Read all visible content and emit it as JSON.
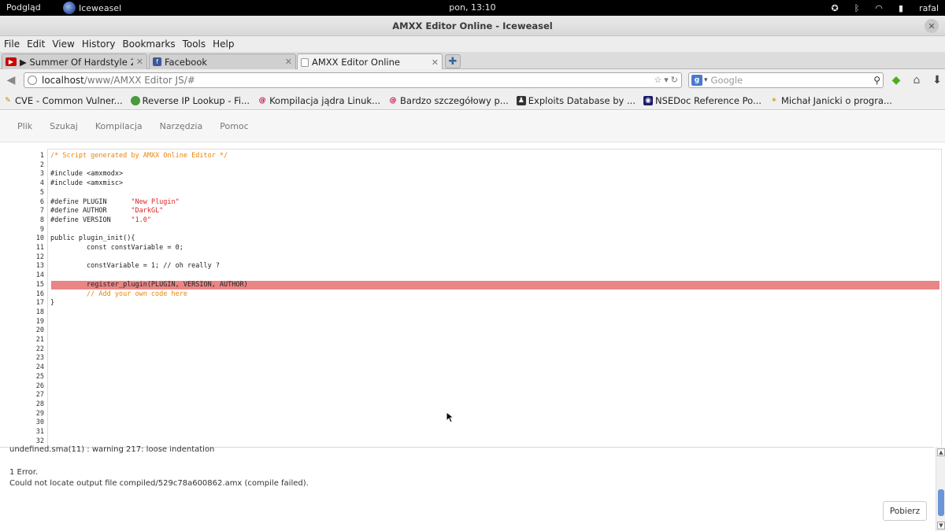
{
  "topbar": {
    "activities": "Podgląd",
    "app_name": "Iceweasel",
    "clock": "pon, 13:10",
    "user": "rafal"
  },
  "window": {
    "title": "AMXX Editor Online - Iceweasel"
  },
  "menu": [
    "File",
    "Edit",
    "View",
    "History",
    "Bookmarks",
    "Tools",
    "Help"
  ],
  "tabs": [
    {
      "label": "▶ Summer Of Hardstyle 20...",
      "icon": "youtube-icon"
    },
    {
      "label": "Facebook",
      "icon": "facebook-icon"
    },
    {
      "label": "AMXX Editor Online",
      "icon": "blank-page-icon"
    }
  ],
  "navbar": {
    "url_host": "localhost",
    "url_path": "/www/AMXX Editor JS/#",
    "search_placeholder": "Google"
  },
  "bookmarks": [
    {
      "label": "CVE - Common Vulner...",
      "icon": "cve-icon",
      "color": "#b58b00"
    },
    {
      "label": "Reverse IP Lookup - Fi...",
      "icon": "globe-icon",
      "color": "#4a9a3a"
    },
    {
      "label": "Kompilacja jądra Linuk...",
      "icon": "debian-icon",
      "color": "#c70036"
    },
    {
      "label": "Bardzo szczegółowy p...",
      "icon": "debian-icon",
      "color": "#c70036"
    },
    {
      "label": "Exploits Database by ...",
      "icon": "exploit-db-icon",
      "color": "#333333"
    },
    {
      "label": "NSEDoc Reference Po...",
      "icon": "nmap-icon",
      "color": "#1b1b6b"
    },
    {
      "label": "Michał Janicki o progra...",
      "icon": "star-icon",
      "color": "#d49a00"
    }
  ],
  "app_menu": [
    "Plik",
    "Szukaj",
    "Kompilacja",
    "Narzędzia",
    "Pomoc"
  ],
  "editor": {
    "line_count": 32,
    "highlighted_line": 15,
    "lines": [
      [
        {
          "t": "/* Script generated by AMXX Online Editor */",
          "c": "comment"
        }
      ],
      [],
      [
        {
          "t": "#include <amxmodx>",
          "c": ""
        }
      ],
      [
        {
          "t": "#include <amxmisc>",
          "c": ""
        }
      ],
      [],
      [
        {
          "t": "#define PLUGIN      ",
          "c": ""
        },
        {
          "t": "\"New Plugin\"",
          "c": "str"
        }
      ],
      [
        {
          "t": "#define AUTHOR      ",
          "c": ""
        },
        {
          "t": "\"DarkGL\"",
          "c": "str"
        }
      ],
      [
        {
          "t": "#define VERSION     ",
          "c": ""
        },
        {
          "t": "\"1.0\"",
          "c": "str"
        }
      ],
      [],
      [
        {
          "t": "public plugin_init(){",
          "c": ""
        }
      ],
      [
        {
          "t": "         const constVariable = 0;",
          "c": ""
        }
      ],
      [],
      [
        {
          "t": "         constVariable = 1; // oh really ?",
          "c": ""
        }
      ],
      [],
      [
        {
          "t": "         register_plugin(PLUGIN, VERSION, AUTHOR)",
          "c": ""
        }
      ],
      [
        {
          "t": "         // Add your own code here",
          "c": "comment"
        }
      ],
      [
        {
          "t": "}",
          "c": ""
        }
      ]
    ]
  },
  "console": {
    "cut_line": "undefined.sma(11) : warning 217: loose indentation",
    "error_count": "1 Error.",
    "error_msg": "Could not locate output file compiled/529c78a600862.amx (compile failed).",
    "download_button": "Pobierz"
  }
}
